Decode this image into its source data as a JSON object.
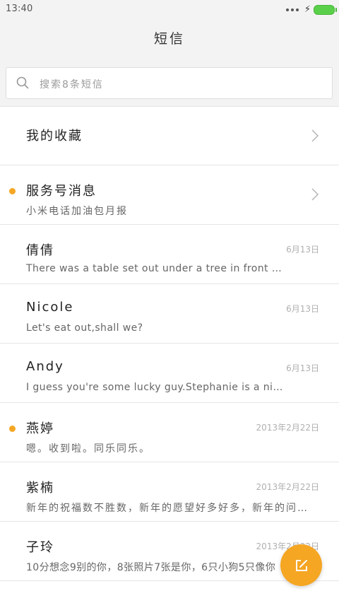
{
  "status_bar": {
    "time": "13:40",
    "icons": [
      "more-dots-icon",
      "charging-bolt-icon",
      "battery-icon"
    ],
    "battery_color": "#5ad04a"
  },
  "header": {
    "title": "短信"
  },
  "search": {
    "placeholder": "搜索8条短信",
    "icon": "search-icon"
  },
  "accent_color": "#f5a623",
  "favorites": {
    "label": "我的收藏",
    "icon": "chevron-right-icon"
  },
  "conversations": [
    {
      "name": "服务号消息",
      "preview": "小米电话加油包月报",
      "date": "",
      "unread": true,
      "has_chevron": true
    },
    {
      "name": "倩倩",
      "preview": "There was a table set out under a tree in front of the hous",
      "date": "6月13日",
      "unread": false
    },
    {
      "name": "Nicole",
      "preview": "Let's eat out,shall we?",
      "date": "6月13日",
      "unread": false
    },
    {
      "name": "Andy",
      "preview": "I guess you're some lucky guy.Stephanie is a nice girl.",
      "date": "6月13日",
      "unread": false
    },
    {
      "name": "燕婷",
      "preview": "嗯。收到啦。同乐同乐。",
      "date": "2013年2月22日",
      "unread": true
    },
    {
      "name": "紫楠",
      "preview": "新年的祝福数不胜数，新年的愿望好多好多，新年的问候…",
      "date": "2013年2月22日",
      "unread": false
    },
    {
      "name": "子玲",
      "preview": "10分想念9别的你，8张照片7张是你，6只小狗5只像你",
      "date": "2013年2月22日",
      "unread": false
    }
  ],
  "compose_button": {
    "icon": "compose-icon"
  }
}
